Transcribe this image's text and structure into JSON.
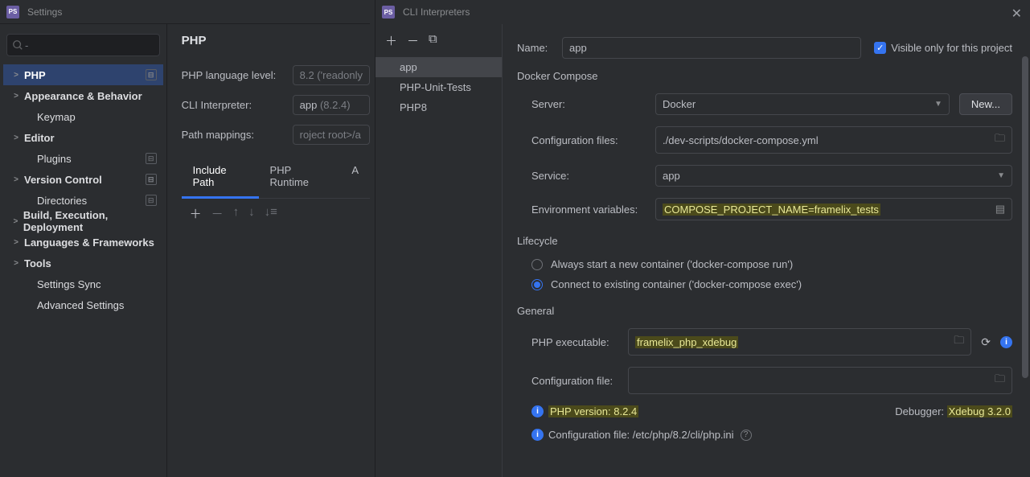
{
  "settings_window": {
    "title": "Settings",
    "search_placeholder": "",
    "tree": [
      {
        "label": "PHP",
        "bold": true,
        "chev": ">",
        "selected": true,
        "badge": true
      },
      {
        "label": "Appearance & Behavior",
        "bold": true,
        "chev": ">"
      },
      {
        "label": "Keymap",
        "indent": true
      },
      {
        "label": "Editor",
        "bold": true,
        "chev": ">"
      },
      {
        "label": "Plugins",
        "indent": true,
        "badge": true
      },
      {
        "label": "Version Control",
        "bold": true,
        "chev": ">",
        "badge": true
      },
      {
        "label": "Directories",
        "indent": true,
        "badge": true
      },
      {
        "label": "Build, Execution, Deployment",
        "bold": true,
        "chev": ">"
      },
      {
        "label": "Languages & Frameworks",
        "bold": true,
        "chev": ">"
      },
      {
        "label": "Tools",
        "bold": true,
        "chev": ">"
      },
      {
        "label": "Settings Sync",
        "indent": true
      },
      {
        "label": "Advanced Settings",
        "indent": true
      }
    ],
    "panel_title": "PHP",
    "lang_level_label": "PHP language level:",
    "lang_level_value": "8.2 ('readonly",
    "cli_label": "CLI Interpreter:",
    "cli_value": "app",
    "cli_version": "(8.2.4)",
    "path_label": "Path mappings:",
    "path_value": "roject root>/a",
    "tabs": [
      "Include Path",
      "PHP Runtime",
      "A"
    ]
  },
  "dialog": {
    "title": "CLI Interpreters",
    "interpreters": [
      "app",
      "PHP-Unit-Tests",
      "PHP8"
    ],
    "selected_interpreter": 0,
    "name_label": "Name:",
    "name_value": "app",
    "visible_label": "Visible only for this project",
    "visible_checked": true,
    "docker_title": "Docker Compose",
    "server_label": "Server:",
    "server_value": "Docker",
    "new_btn": "New...",
    "config_files_label": "Configuration files:",
    "config_files_value": "./dev-scripts/docker-compose.yml",
    "service_label": "Service:",
    "service_value": "app",
    "env_label": "Environment variables:",
    "env_value": "COMPOSE_PROJECT_NAME=framelix_tests",
    "lifecycle_title": "Lifecycle",
    "radio1": "Always start a new container ('docker-compose run')",
    "radio2": "Connect to existing container ('docker-compose exec')",
    "radio_selected": 1,
    "general_title": "General",
    "php_exec_label": "PHP executable:",
    "php_exec_value": "framelix_php_xdebug",
    "config_file_label": "Configuration file:",
    "config_file_value": "",
    "php_version_label": "PHP version:",
    "php_version_value": "8.2.4",
    "debugger_label": "Debugger:",
    "debugger_value": "Xdebug 3.2.0",
    "config_info_label": "Configuration file:",
    "config_info_value": "/etc/php/8.2/cli/php.ini"
  }
}
